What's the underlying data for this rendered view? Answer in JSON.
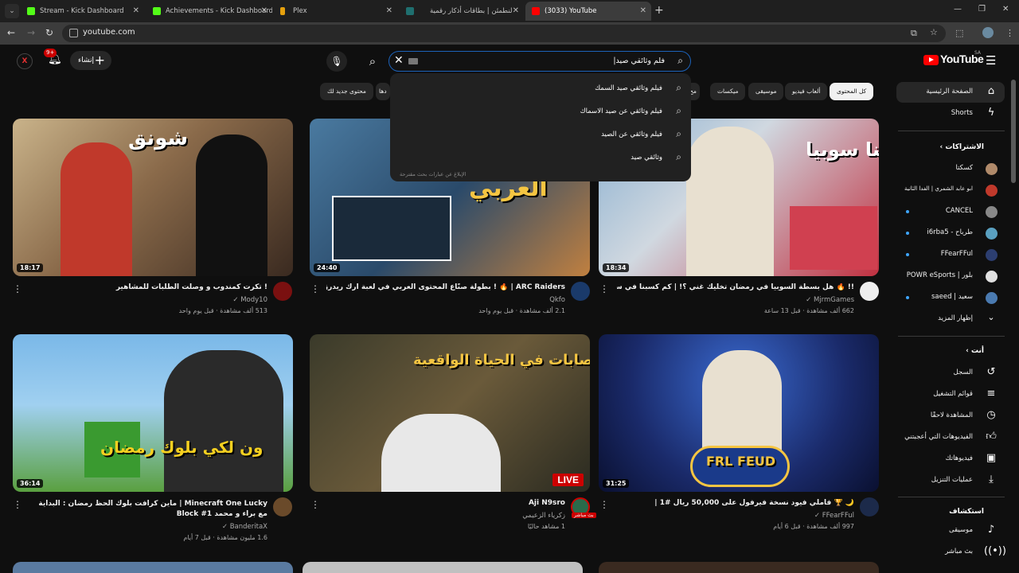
{
  "browser": {
    "tabs": [
      {
        "label": "Stream - Kick Dashboard",
        "color": "#53fc18"
      },
      {
        "label": "Achievements - Kick Dashboard",
        "color": "#53fc18"
      },
      {
        "label": "Plex",
        "color": "#e5a00d"
      },
      {
        "label": "لنطمئن | بطاقات أذكار رقمية",
        "color": "#1f6f6f"
      },
      {
        "label": "(3033) YouTube",
        "color": "#ff0000"
      }
    ],
    "url": "youtube.com"
  },
  "masthead": {
    "create_label": "إنشاء",
    "notif_count": "9+",
    "search_query": "فلم وثائقي صيد|",
    "logo_text": "YouTube",
    "country": "SA"
  },
  "suggestions": {
    "items": [
      "فيلم وثائقي صيد السمك",
      "فيلم وثائقي عن صيد الاسماك",
      "فيلم وثائقي عن الصيد",
      "وثائقي صيد"
    ],
    "report": "الإبلاغ عن عبارات بحث مقترحة"
  },
  "chips": [
    "كل المحتوى",
    "ألعاب فيديو",
    "موسيقى",
    "ميكسات",
    "مح",
    "دها",
    "محتوى جديد لك"
  ],
  "sidebar": {
    "main": [
      "الصفحة الرئيسية",
      "Shorts"
    ],
    "subs_header": "الاشتراكات",
    "subs": [
      {
        "name": "كسكتا",
        "color": "#b08a6a",
        "dot": false
      },
      {
        "name": "ابو عابد الشمري | الفدا الثانية",
        "color": "#c0392b",
        "dot": false
      },
      {
        "name": "CANCEL",
        "color": "#888888",
        "dot": true
      },
      {
        "name": "طرباح - i6rba5",
        "color": "#5aa0c0",
        "dot": true
      },
      {
        "name": "FFearFFul",
        "color": "#2c3e70",
        "dot": true
      },
      {
        "name": "بلور | POWR eSports",
        "color": "#e0e0e0",
        "dot": false
      },
      {
        "name": "سعيد | saeed",
        "color": "#4a7ab0",
        "dot": true
      }
    ],
    "show_more": "إظهار المزيد",
    "you_header": "أنت",
    "you": [
      "السجل",
      "قوائم التشغيل",
      "المشاهدة لاحقًا",
      "الفيديوهات التي أعجبتني",
      "فيديوهاتك",
      "عمليات التنزيل"
    ],
    "explore_header": "استكشاف",
    "explore": [
      "موسيقى",
      "بث مباشر"
    ]
  },
  "videos": [
    {
      "title": "! تكرت كمندوب و وصلت الطلبات للمشاهير",
      "channel": "Mody10",
      "meta": "513 ألف مشاهدة · قبل يوم واحد",
      "duration": "18:17",
      "thumb_text": "شونق",
      "avatar": "#7a1010"
    },
    {
      "title": "ARC Raiders | 🔥 ! بطولة صنّاع المحتوى العربي في لعبة ارك ريدرز",
      "channel": "Qkfo",
      "meta": "2.1 ألف مشاهدة · قبل يوم واحد",
      "duration": "24:40",
      "thumb_text": "العربي",
      "avatar": "#1a3a6a"
    },
    {
      "title": "!! 🔥 هل بسطة السوبيا في رمضان تخليك غني ؟! | كم كسبنا في ساعة",
      "channel": "MjrmGames",
      "meta": "662 ألف مشاهدة · قبل 13 ساعة",
      "duration": "18:34",
      "thumb_text": "بعنا سوبيا",
      "avatar": "#eeeeee"
    },
    {
      "title": "Minecraft One Lucky | ماين كرافت بلوك الحظ رمضان : البداية مع براء و محمد Block #1",
      "channel": "BanderitaX",
      "meta": "1.6 مليون مشاهدة · قبل 7 أيام",
      "duration": "36:14",
      "thumb_text": "ون لكي بلوك رمضان",
      "avatar": "#6a4a2a"
    },
    {
      "title": "Aji N9sro",
      "channel": "زكرياء الزعيمي",
      "meta": "1 مشاهد حاليًا",
      "duration": "",
      "live": "LIVE",
      "thumb_text": "اخطر العصابات في الحياة الواقعية",
      "avatar": "#2a6a4a",
      "live_mini": "بث مباشر"
    },
    {
      "title": "🌙 🏆 فاملي فيود نسخة فيرفول على 50,000 ريال #1 |",
      "channel": "FFearFFul",
      "meta": "997 ألف مشاهدة · قبل 6 أيام",
      "duration": "31:25",
      "thumb_text": "FRL FEUD",
      "avatar": "#1c2a4a"
    }
  ]
}
